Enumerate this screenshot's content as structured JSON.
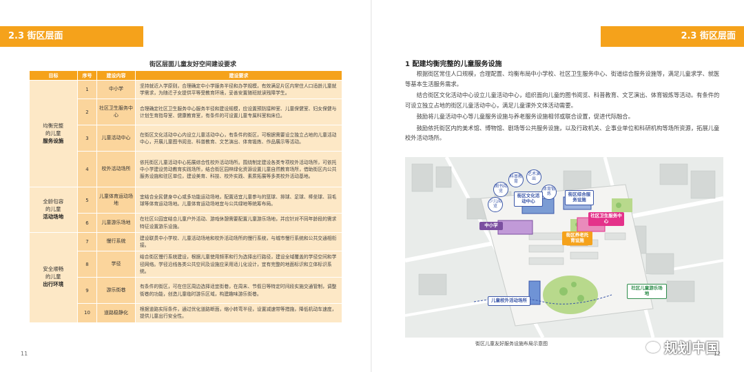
{
  "left_page": {
    "section": "2.3 街区层面",
    "table_title": "街区层面儿童友好空间建设要求",
    "headers": [
      "目标",
      "序号",
      "建设内容",
      "建设要求"
    ],
    "groups": [
      {
        "goal_line1": "均衡完整",
        "goal_line2": "的儿童",
        "goal_line3": "服务设施"
      },
      {
        "goal_line1": "全龄包容",
        "goal_line2": "的儿童",
        "goal_line3": "活动场地"
      },
      {
        "goal_line1": "安全顺畅",
        "goal_line2": "的儿童",
        "goal_line3": "出行环境"
      }
    ],
    "rows": [
      {
        "num": "1",
        "content": "中小学",
        "req": "坚持就近入学原则，合理确定中小学服务半径和办学规模，有效满足片区内常住人口适龄儿童就学需求，为随迁子女提供平等受教育环境，妥善安置随班就读残障学生。"
      },
      {
        "num": "2",
        "content": "社区卫生服务中心",
        "req": "合理确定社区卫生服务中心服务半径和建设规模，应设置预防接种室、儿童保健室、妇女保健与计划生育指导室、健康教育室，有条件的可设置儿童专属科室和床位。"
      },
      {
        "num": "3",
        "content": "儿童活动中心",
        "req": "在街区文化活动中心内设立儿童活动中心，有条件的街区，可根据需要设立独立占地的儿童活动中心，开展儿童图书阅览、科普教育、文艺演出、体育锻炼、作品展示等活动。"
      },
      {
        "num": "4",
        "content": "校外活动场所",
        "req": "依托街区儿童活动中心拓展综合性校外活动场所。围绕制定建设各类专项校外活动场所，可依托中小学建设劳动教育实践场所，结合街区园林绿化资源设置儿童自然教育场所，借助街区内公共服务设施和驻区单位，建设美育、科技、校外实践、素质拓展等多类校外活动基地。"
      },
      {
        "num": "5",
        "content": "儿童体育运动场地",
        "req": "宜结合全民健身中心或多功能运动场地，配置适宜儿童参与的篮球、排球、足球、棒垒球、羽毛球等体育运动场地。儿童体育运动场地宜与公共绿地等统筹布局。"
      },
      {
        "num": "6",
        "content": "儿童游乐场地",
        "req": "在社区公园宜结合儿童户外活动、游戏休憩需要配置儿童游乐场地，并应针对不同年龄段的需求特征设置游乐设施。"
      },
      {
        "num": "7",
        "content": "慢行系统",
        "req": "建设联贯中小学校、儿童活动场地和校外活动场所的慢行系统，与城市慢行系统和公共交通相衔接。"
      },
      {
        "num": "8",
        "content": "学径",
        "req": "结合街区慢行系统建设，根据儿童使用频率和行为选择出行路径，建设全域覆盖的学径空间和学径网络。学径沿线各类公共空间及设施应采用适儿化设计，宜有完整的地面标识和立体标识系统。"
      },
      {
        "num": "9",
        "content": "游乐街巷",
        "req": "有条件的街区，可在住区周边选择适宜街巷，在周末、节假日等特定时间段实施交通管制，调整街巷的功能，创造儿童临时游乐区域，构建趣味游乐街巷。"
      },
      {
        "num": "10",
        "content": "道路稳静化",
        "req": "根据道路实际条件，通过优化道路断面，缩小转弯半径，设置减速带等措施，降低机动车速度，提供儿童出行安全性。"
      }
    ],
    "page_number": "11"
  },
  "right_page": {
    "section": "2.3 街区层面",
    "subheading": "1 配建均衡完整的儿童服务设施",
    "paragraphs": [
      "根据街区常住人口规模，合理配置、均衡布局中小学校、社区卫生服务中心、街道综合服务设施等，满足儿童求学、就医等基本生活服务需求。",
      "结合街区文化活动中心设立儿童活动中心，组织面向儿童的图书阅览、科普教育、文艺演出、体育锻炼等活动。有条件的可设立独立占地的街区儿童活动中心，满足儿童课外文体活动需要。",
      "鼓励将儿童活动中心等儿童服务设施与养老服务设施相邻或联合设置，促进代际融合。",
      "鼓励依托街区内的美术馆、博物馆、剧场等公共服务设施，以及行政机关、企事业单位和科研机构等场所资源，拓展儿童校外活动场所。"
    ],
    "map_labels": {
      "b1": "科普教育",
      "b2": "艺术演出",
      "b3": "图书阅览",
      "b4": "少儿阅览",
      "b5": "体育锻炼",
      "culture": "街区文化活动中心",
      "service": "街区综合服务设施",
      "school": "中小学",
      "health": "社区卫生服务中心",
      "elderly": "街区养老托育设施",
      "playground": "社区儿童游乐场地",
      "outdoor": "儿童校外活动场所"
    },
    "map_caption": "街区儿童友好服务设施布局示意图",
    "watermark": "规划中国",
    "page_number": "12"
  },
  "colors": {
    "accent": "#f5a21b",
    "goal_bg": "#fde8c6",
    "content_bg": "#fbd59c",
    "map_blue": "#3a56a8",
    "map_pink": "#e4328a",
    "map_purple": "#7b4fa0"
  }
}
